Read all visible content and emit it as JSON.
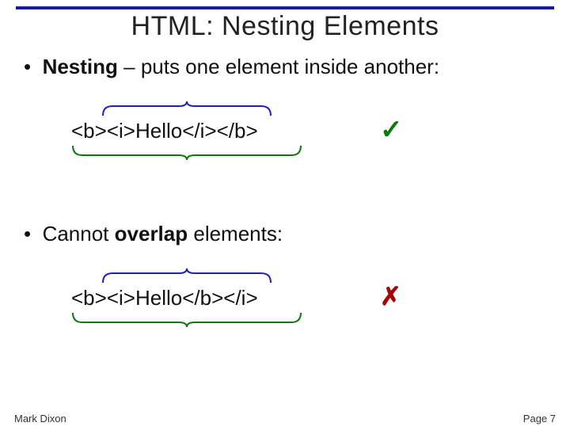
{
  "title": "HTML: Nesting Elements",
  "point1_prefix": "Nesting",
  "point1_rest": " – puts one element inside another:",
  "code1": "<b><i>Hello</i></b>",
  "point2_prefix": "Cannot ",
  "point2_bold": "overlap",
  "point2_rest": " elements:",
  "code2": "<b><i>Hello</b></i>",
  "footer_author": "Mark Dixon",
  "footer_page": "Page 7",
  "check": "✓",
  "cross": "✗"
}
